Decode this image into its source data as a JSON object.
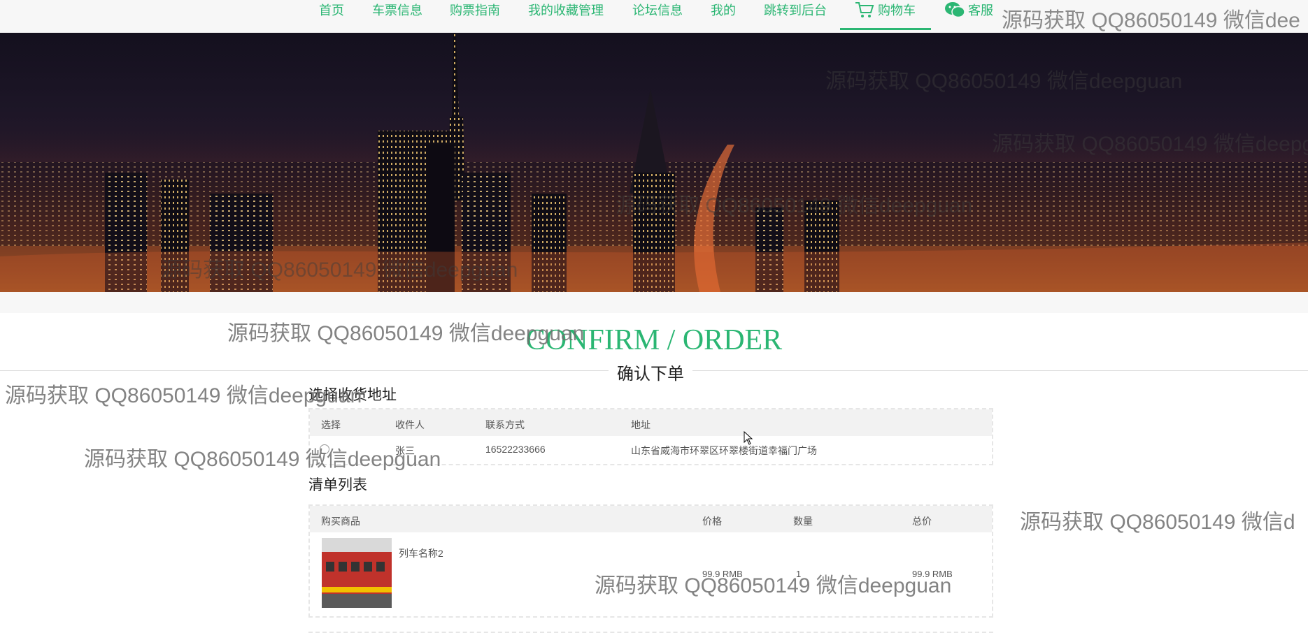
{
  "nav": {
    "items": [
      "首页",
      "车票信息",
      "购票指南",
      "我的收藏管理",
      "论坛信息",
      "我的",
      "跳转到后台"
    ],
    "cart": "购物车",
    "service": "客服"
  },
  "watermark": "源码获取 QQ86050149 微信deepguan",
  "watermark_partial_top": "源码获取 QQ86050149 微信dee",
  "watermark_partial_right": "源码获取 QQ86050149 微信d",
  "section": {
    "title_en": "CONFIRM / ORDER",
    "title_cn": "确认下单"
  },
  "address": {
    "heading": "选择收货地址",
    "columns": [
      "选择",
      "收件人",
      "联系方式",
      "地址"
    ],
    "rows": [
      {
        "recipient": "张三",
        "phone": "16522233666",
        "address": "山东省威海市环翠区环翠楼街道幸福门广场"
      }
    ]
  },
  "order_list": {
    "heading": "清单列表",
    "columns": [
      "购买商品",
      "价格",
      "数量",
      "总价"
    ],
    "items": [
      {
        "name": "列车名称2",
        "price": "99.9 RMB",
        "quantity": "1",
        "total": "99.9 RMB"
      }
    ]
  },
  "colors": {
    "accent": "#2bb673",
    "nav_bg": "#f7f7f7",
    "table_head_bg": "#f2f2f2"
  }
}
